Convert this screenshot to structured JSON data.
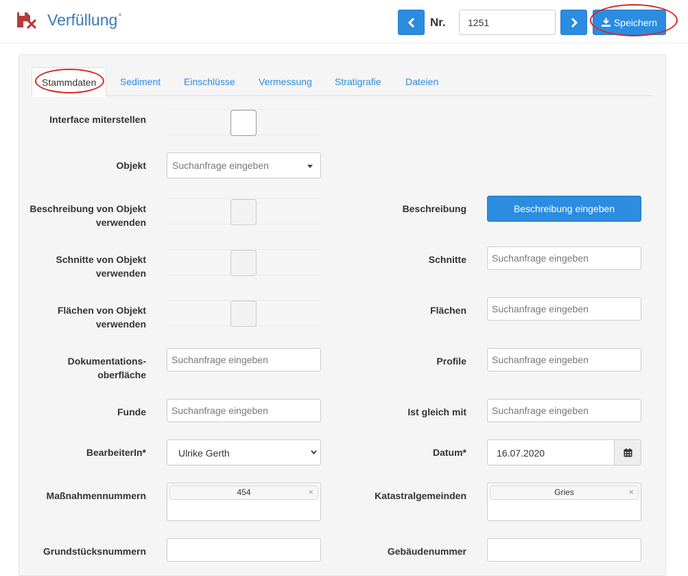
{
  "header": {
    "title": "Verfüllung",
    "title_star": "*",
    "nr_label": "Nr.",
    "nr_value": "1251",
    "save_label": "Speichern"
  },
  "tabs": [
    {
      "label": "Stammdaten"
    },
    {
      "label": "Sediment"
    },
    {
      "label": "Einschlüsse"
    },
    {
      "label": "Vermessung"
    },
    {
      "label": "Stratigrafie"
    },
    {
      "label": "Dateien"
    }
  ],
  "form": {
    "interface_label": "Interface miterstellen",
    "objekt_label": "Objekt",
    "objekt_placeholder": "Suchanfrage eingeben",
    "beschreibung_von_objekt_label": "Beschreibung von Objekt verwenden",
    "schnitte_von_objekt_label": "Schnitte von Objekt verwenden",
    "flaechen_von_objekt_label": "Flächen von Objekt verwenden",
    "dokumentation_label_1": "Dokumentations-",
    "dokumentation_label_2": "oberfläche",
    "dokumentation_placeholder": "Suchanfrage eingeben",
    "funde_label": "Funde",
    "funde_placeholder": "Suchanfrage eingeben",
    "bearbeiter_label": "BearbeiterIn*",
    "bearbeiter_value": "Ulrike Gerth",
    "massnahmen_label": "Maßnahmennummern",
    "massnahmen_tag": "454",
    "grundstueck_label": "Grundstücksnummern",
    "beschreibung_label": "Beschreibung",
    "beschreibung_button": "Beschreibung eingeben",
    "schnitte_label": "Schnitte",
    "schnitte_placeholder": "Suchanfrage eingeben",
    "flaechen_label": "Flächen",
    "flaechen_placeholder": "Suchanfrage eingeben",
    "profile_label": "Profile",
    "profile_placeholder": "Suchanfrage eingeben",
    "ist_gleich_label": "Ist gleich mit",
    "ist_gleich_placeholder": "Suchanfrage eingeben",
    "datum_label": "Datum*",
    "datum_value": "16.07.2020",
    "kataster_label": "Katastralgemeinden",
    "kataster_tag": "Gries",
    "gebaeude_label": "Gebäudenummer",
    "tag_remove": "×"
  },
  "colors": {
    "primary": "#2b8ce0",
    "title": "#3a7ab5",
    "logo": "#b83b3b",
    "annotation": "#d9261c"
  }
}
